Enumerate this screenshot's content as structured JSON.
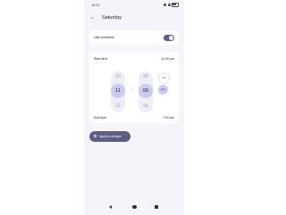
{
  "status_bar": {
    "time": "10:01"
  },
  "app_bar": {
    "back_icon": "back-arrow-icon",
    "title": "Saturday"
  },
  "downtime": {
    "label": "Use downtime",
    "enabled": true
  },
  "start_time": {
    "label": "Start time",
    "value": "11:00 pm",
    "hours": {
      "prev": "10",
      "selected": "11",
      "next": "12"
    },
    "minutes": {
      "prev": "59",
      "selected": "00",
      "next": "01"
    },
    "am_label": "am",
    "pm_label": "pm",
    "selected_period": "pm"
  },
  "end_time": {
    "label": "End time",
    "value": "7:00 am"
  },
  "apply_button": {
    "label": "Apply to all days",
    "icon": "copy-icon"
  },
  "colors": {
    "accent": "#5e5e85",
    "selection": "#c9cbf2",
    "background": "#f6f3fa"
  }
}
